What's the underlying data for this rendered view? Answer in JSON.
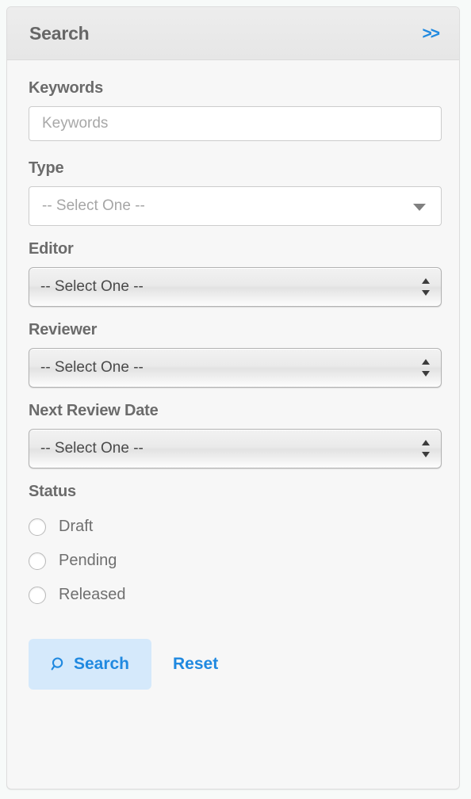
{
  "panel": {
    "title": "Search",
    "expand_icon_label": ">>",
    "accent_color": "#2089e0",
    "header_bg": "#e9e9e9",
    "body_bg": "#f7f7f7",
    "button_bg": "#d5e9fb"
  },
  "fields": {
    "keywords": {
      "label": "Keywords",
      "placeholder": "Keywords",
      "value": ""
    },
    "type": {
      "label": "Type",
      "selected": "-- Select One --"
    },
    "editor": {
      "label": "Editor",
      "selected": "-- Select One --"
    },
    "reviewer": {
      "label": "Reviewer",
      "selected": "-- Select One --"
    },
    "next_review_date": {
      "label": "Next Review Date",
      "selected": "-- Select One --"
    },
    "status": {
      "label": "Status",
      "options": [
        {
          "label": "Draft",
          "checked": false
        },
        {
          "label": "Pending",
          "checked": false
        },
        {
          "label": "Released",
          "checked": false
        }
      ]
    }
  },
  "actions": {
    "search_label": "Search",
    "search_icon": "magnifying-glass-icon",
    "reset_label": "Reset"
  }
}
